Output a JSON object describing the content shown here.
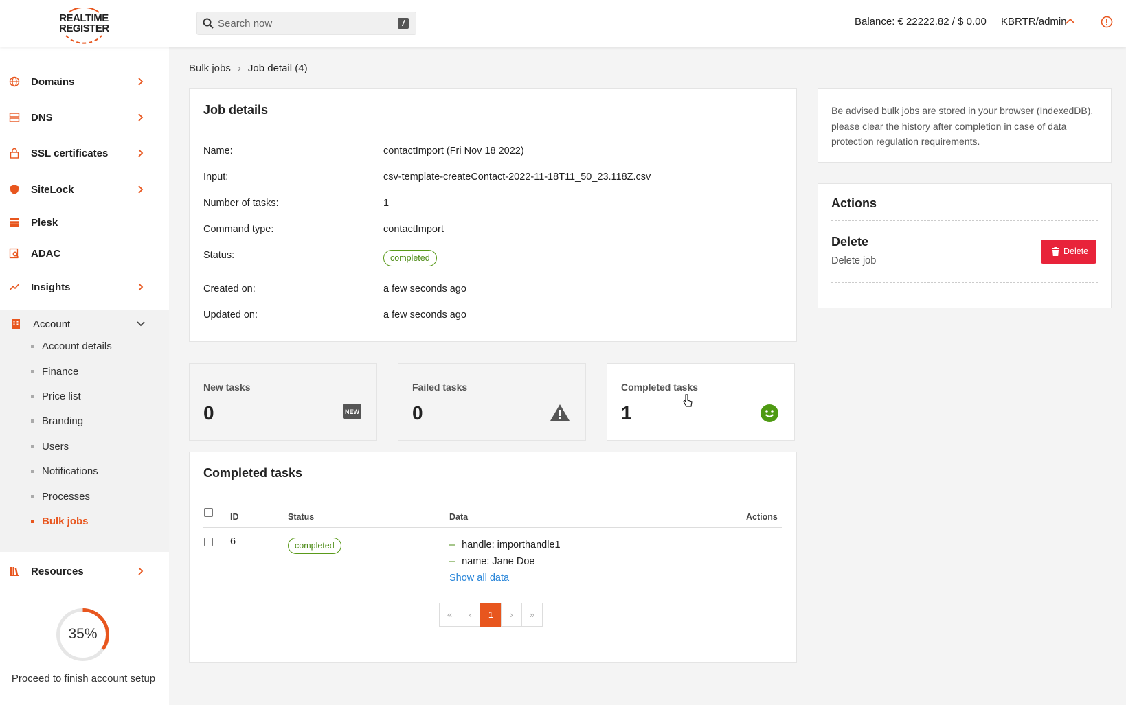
{
  "brand": {
    "logo_line1": "REALTIME",
    "logo_line2": "REGISTER",
    "accent": "#e8561e"
  },
  "header": {
    "search_placeholder": "Search now",
    "search_shortcut": "/",
    "balance": "Balance: € 22222.82 / $ 0.00",
    "user": "KBRTR/admin"
  },
  "sidebar": {
    "items": [
      {
        "label": "Domains",
        "icon": "globe-icon"
      },
      {
        "label": "DNS",
        "icon": "server-icon"
      },
      {
        "label": "SSL certificates",
        "icon": "lock-icon"
      },
      {
        "label": "SiteLock",
        "icon": "shield-icon"
      },
      {
        "label": "Plesk",
        "icon": "stack-icon"
      },
      {
        "label": "ADAC",
        "icon": "search-doc-icon"
      },
      {
        "label": "Insights",
        "icon": "trend-icon"
      },
      {
        "label": "Account",
        "icon": "building-icon"
      },
      {
        "label": "Resources",
        "icon": "books-icon"
      }
    ],
    "account_sub": [
      "Account details",
      "Finance",
      "Price list",
      "Branding",
      "Users",
      "Notifications",
      "Processes",
      "Bulk jobs"
    ],
    "active_sub": "Bulk jobs",
    "setup_progress_percent": 35,
    "setup_progress_label": "35%",
    "setup_text": "Proceed to finish account setup"
  },
  "breadcrumb": {
    "parent": "Bulk jobs",
    "current": "Job detail (4)"
  },
  "job": {
    "title": "Job details",
    "rows": [
      {
        "label": "Name:",
        "value": "contactImport (Fri Nov 18 2022)"
      },
      {
        "label": "Input:",
        "value": "csv-template-createContact-2022-11-18T11_50_23.118Z.csv"
      },
      {
        "label": "Number of tasks:",
        "value": "1"
      },
      {
        "label": "Command type:",
        "value": "contactImport"
      },
      {
        "label": "Status:",
        "value": "completed"
      },
      {
        "label": "Created on:",
        "value": "a few seconds ago"
      },
      {
        "label": "Updated on:",
        "value": "a few seconds ago"
      }
    ]
  },
  "stats": [
    {
      "label": "New tasks",
      "value": "0",
      "icon": "new-badge-icon"
    },
    {
      "label": "Failed tasks",
      "value": "0",
      "icon": "warning-icon"
    },
    {
      "label": "Completed tasks",
      "value": "1",
      "icon": "smiley-icon"
    }
  ],
  "completed": {
    "title": "Completed tasks",
    "columns": [
      "ID",
      "Status",
      "Data",
      "Actions"
    ],
    "rows": [
      {
        "id": "6",
        "status": "completed",
        "data": [
          "handle: importhandle1",
          "name: Jane Doe"
        ],
        "show_all": "Show all data"
      }
    ],
    "pager": [
      "«",
      "‹",
      "1",
      "›",
      "»"
    ]
  },
  "notice": "Be advised bulk jobs are stored in your browser (IndexedDB), please clear the history after completion in case of data protection regulation requirements.",
  "actions": {
    "title": "Actions",
    "delete_heading": "Delete",
    "delete_desc": "Delete job",
    "delete_button": "Delete"
  }
}
